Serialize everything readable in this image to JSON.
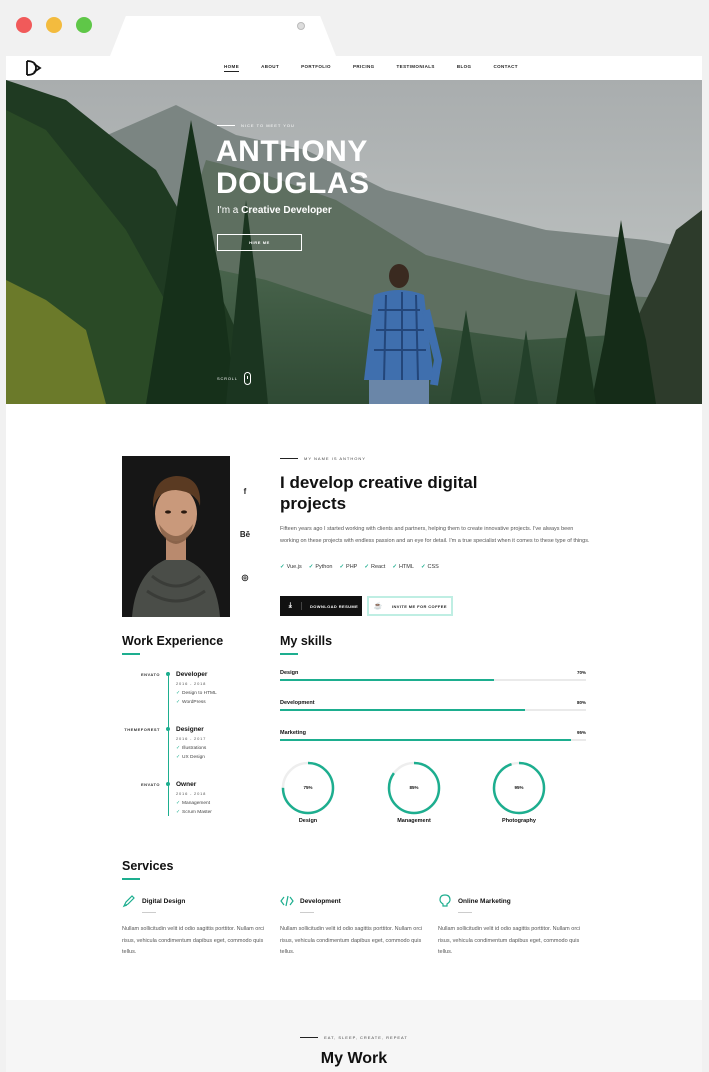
{
  "nav": {
    "items": [
      "HOME",
      "ABOUT",
      "PORTFOLIO",
      "PRICING",
      "TESTIMONIALS",
      "BLOG",
      "CONTACT"
    ]
  },
  "hero": {
    "eyebrow": "NICE TO MEET YOU",
    "name_line1": "ANTHONY",
    "name_line2": "DOUGLAS",
    "role_prefix": "I'm a ",
    "role_strong": "Creative Developer",
    "cta": "HIRE ME",
    "scroll": "SCROLL"
  },
  "about": {
    "eyebrow": "MY NAME IS ANTHONY",
    "title": "I develop creative digital projects",
    "text": "Fifteen years ago I started working with clients and partners, helping them to create innovative projects. I've always been working on these projects with endless passion and an eye for detail. I'm a true specialist when it comes to these type of things.",
    "technologies": [
      "Vue.js",
      "Python",
      "PHP",
      "React",
      "HTML",
      "CSS"
    ],
    "download_label": "DOWNLOAD RESUME",
    "coffee_label": "INVITE ME FOR COFFEE",
    "socials": [
      "f",
      "Bē",
      "◎"
    ]
  },
  "experience": {
    "title": "Work Experience",
    "items": [
      {
        "company": "ENVATO",
        "role": "Developer",
        "years": "2016 - 2018",
        "bullets": [
          "Design to HTML",
          "WordPress"
        ]
      },
      {
        "company": "THEMEFOREST",
        "role": "Designer",
        "years": "2016 - 2017",
        "bullets": [
          "Illustrations",
          "UX Design"
        ]
      },
      {
        "company": "ENVATO",
        "role": "Owner",
        "years": "2016 - 2018",
        "bullets": [
          "Management",
          "Scrum Master"
        ]
      }
    ]
  },
  "skills": {
    "title": "My skills",
    "bars": [
      {
        "name": "Design",
        "value": 70,
        "label": "70%"
      },
      {
        "name": "Development",
        "value": 80,
        "label": "80%"
      },
      {
        "name": "Marketing",
        "value": 95,
        "label": "95%"
      }
    ],
    "circles": [
      {
        "name": "Design",
        "value": 75,
        "label": "75%"
      },
      {
        "name": "Management",
        "value": 85,
        "label": "85%"
      },
      {
        "name": "Photography",
        "value": 95,
        "label": "95%"
      }
    ]
  },
  "services": {
    "title": "Services",
    "items": [
      {
        "icon": "pen-icon",
        "title": "Digital Design",
        "text": "Nullam sollicitudin velit id odio sagittis porttitor. Nullam orci risus, vehicula condimentum dapibus eget, commodo quis tellus."
      },
      {
        "icon": "code-icon",
        "title": "Development",
        "text": "Nullam sollicitudin velit id odio sagittis porttitor. Nullam orci risus, vehicula condimentum dapibus eget, commodo quis tellus."
      },
      {
        "icon": "bulb-icon",
        "title": "Online Marketing",
        "text": "Nullam sollicitudin velit id odio sagittis porttitor. Nullam orci risus, vehicula condimentum dapibus eget, commodo quis tellus."
      }
    ]
  },
  "mywork": {
    "eyebrow": "EAT, SLEEP, CREATE, REPEAT",
    "title": "My Work"
  },
  "colors": {
    "accent": "#1dae8f",
    "dark": "#111111"
  }
}
